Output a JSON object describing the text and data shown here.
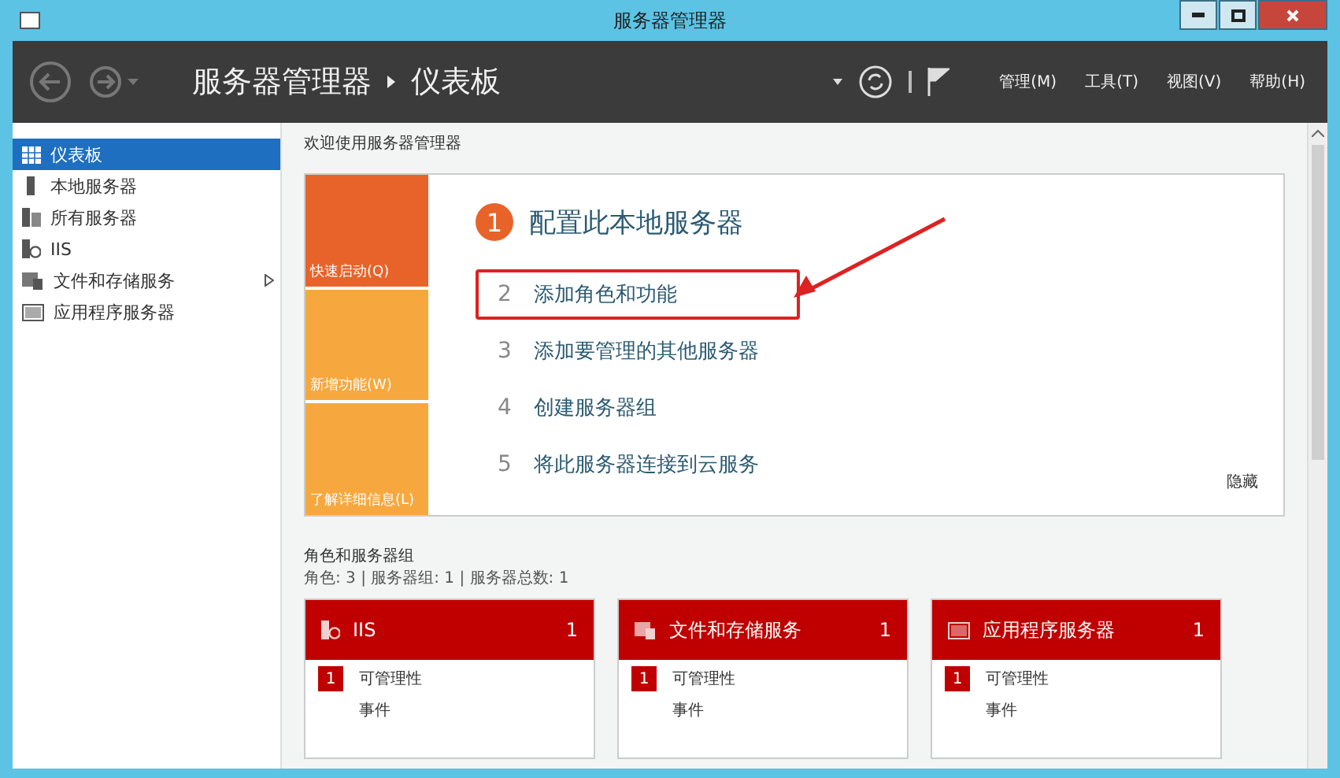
{
  "window": {
    "title": "服务器管理器"
  },
  "header": {
    "breadcrumb": [
      "服务器管理器",
      "仪表板"
    ],
    "menus": [
      "管理(M)",
      "工具(T)",
      "视图(V)",
      "帮助(H)"
    ]
  },
  "sidebar": {
    "items": [
      {
        "label": "仪表板",
        "kind": "dashboard",
        "selected": true,
        "expandable": false
      },
      {
        "label": "本地服务器",
        "kind": "server",
        "selected": false,
        "expandable": false
      },
      {
        "label": "所有服务器",
        "kind": "servers",
        "selected": false,
        "expandable": false
      },
      {
        "label": "IIS",
        "kind": "iis",
        "selected": false,
        "expandable": false
      },
      {
        "label": "文件和存储服务",
        "kind": "files",
        "selected": false,
        "expandable": true
      },
      {
        "label": "应用程序服务器",
        "kind": "app",
        "selected": false,
        "expandable": false
      }
    ]
  },
  "welcome": {
    "title": "欢迎使用服务器管理器",
    "tiles": [
      {
        "label": "快速启动(Q)",
        "selected": true
      },
      {
        "label": "新增功能(W)",
        "selected": false
      },
      {
        "label": "了解详细信息(L)",
        "selected": false
      }
    ],
    "step": {
      "number": "1",
      "title": "配置此本地服务器"
    },
    "tasks": [
      {
        "number": "2",
        "label": "添加角色和功能",
        "highlighted": true
      },
      {
        "number": "3",
        "label": "添加要管理的其他服务器",
        "highlighted": false
      },
      {
        "number": "4",
        "label": "创建服务器组",
        "highlighted": false
      },
      {
        "number": "5",
        "label": "将此服务器连接到云服务",
        "highlighted": false
      }
    ],
    "hide": "隐藏"
  },
  "roles": {
    "title": "角色和服务器组",
    "summary": "角色: 3 | 服务器组: 1 | 服务器总数: 1",
    "cards": [
      {
        "name": "IIS",
        "kind": "iis",
        "count": "1",
        "rows": [
          {
            "badge": "1",
            "label": "可管理性"
          },
          {
            "label": "事件"
          }
        ]
      },
      {
        "name": "文件和存储服务",
        "kind": "files",
        "count": "1",
        "rows": [
          {
            "badge": "1",
            "label": "可管理性"
          },
          {
            "label": "事件"
          }
        ]
      },
      {
        "name": "应用程序服务器",
        "kind": "app",
        "count": "1",
        "rows": [
          {
            "badge": "1",
            "label": "可管理性"
          },
          {
            "label": "事件"
          }
        ]
      }
    ]
  }
}
